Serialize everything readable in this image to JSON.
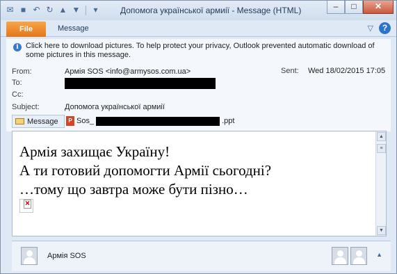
{
  "window": {
    "title": "Допомога української армиії  - Message (HTML)"
  },
  "quick_access": {
    "icons": [
      "mail-icon",
      "save-icon",
      "undo-icon",
      "redo-icon",
      "up-arrow-icon",
      "down-arrow-icon",
      "customize-icon"
    ]
  },
  "ribbon": {
    "file_tab": "File",
    "message_tab": "Message"
  },
  "infobar": {
    "text": "Click here to download pictures. To help protect your privacy, Outlook prevented automatic download of some pictures in this message."
  },
  "header": {
    "from_label": "From:",
    "from_value": "Армія SOS <info@armysos.com.ua>",
    "to_label": "To:",
    "cc_label": "Cc:",
    "subject_label": "Subject:",
    "subject_value": "Допомога української армиії",
    "sent_label": "Sent:",
    "sent_value": "Wed 18/02/2015 17:05"
  },
  "attachments": {
    "message_label": "Message",
    "file_prefix": "Sos_",
    "file_suffix": ".ppt"
  },
  "body": {
    "line1": "Армія захищає Україну!",
    "line2": "А ти готовий допомогти Армії сьогодні?",
    "line3": "…тому що завтра може бути пізно…"
  },
  "people_pane": {
    "name": "Армія SOS"
  },
  "colors": {
    "file_tab": "#e4761c",
    "title_text": "#1e395b",
    "close_button": "#c85a3e",
    "help_icon": "#2a74c9"
  }
}
